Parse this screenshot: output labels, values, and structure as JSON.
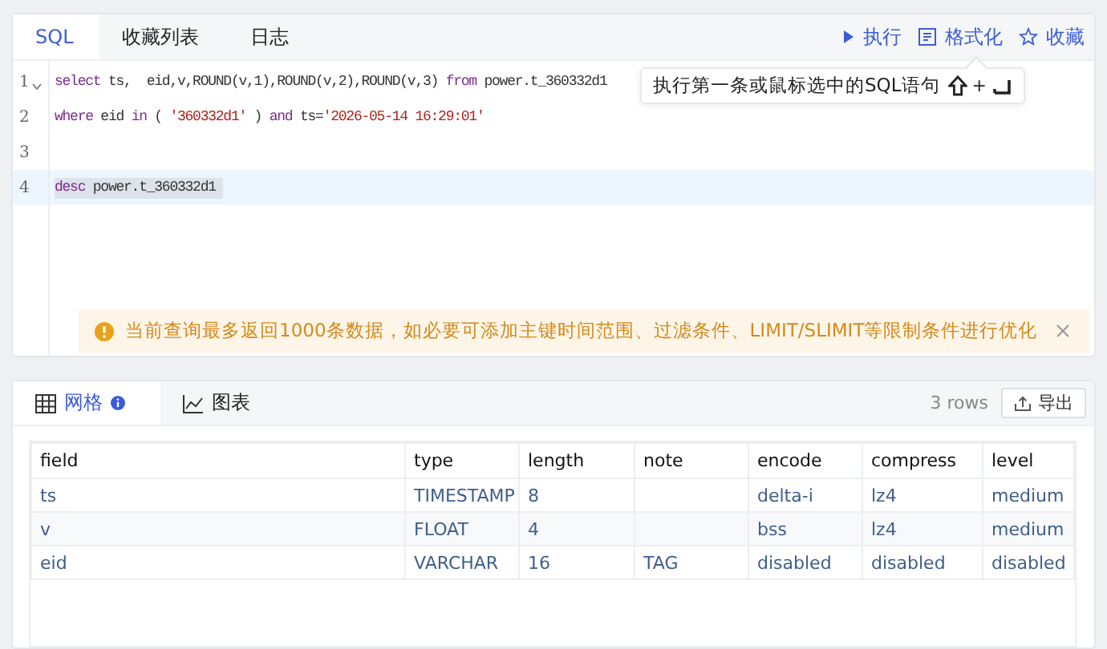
{
  "editor_tabs": [
    {
      "label": "SQL",
      "selected": true
    },
    {
      "label": "收藏列表",
      "selected": false
    },
    {
      "label": "日志",
      "selected": false
    }
  ],
  "toolbar": [
    {
      "kind": "run",
      "label": "执行"
    },
    {
      "kind": "format",
      "label": "格式化"
    },
    {
      "kind": "favorite",
      "label": "收藏"
    }
  ],
  "tooltip": {
    "text": "执行第一条或鼠标选中的SQL语句",
    "plus": "+"
  },
  "code_lines": [
    {
      "number": "1",
      "foldable": true,
      "active": false,
      "selected": false,
      "tokens": [
        {
          "kind": "keyword",
          "text": "select"
        },
        {
          "kind": "plain",
          "text": " ts,  eid,v,ROUND(v,1),ROUND(v,2),ROUND(v,3) "
        },
        {
          "kind": "keyword",
          "text": "from"
        },
        {
          "kind": "plain",
          "text": " power.t_360332d1"
        }
      ]
    },
    {
      "number": "2",
      "foldable": false,
      "active": false,
      "selected": false,
      "tokens": [
        {
          "kind": "keyword",
          "text": "where"
        },
        {
          "kind": "plain",
          "text": " eid "
        },
        {
          "kind": "keyword",
          "text": "in"
        },
        {
          "kind": "plain",
          "text": " ( "
        },
        {
          "kind": "string",
          "text": "'360332d1'"
        },
        {
          "kind": "plain",
          "text": " ) "
        },
        {
          "kind": "keyword",
          "text": "and"
        },
        {
          "kind": "plain",
          "text": " ts="
        },
        {
          "kind": "string",
          "text": "'2026-05-14 16:29:01'"
        }
      ]
    },
    {
      "number": "3",
      "foldable": false,
      "active": false,
      "selected": false
    },
    {
      "number": "4",
      "foldable": false,
      "active": true,
      "selected": true,
      "tokens": [
        {
          "kind": "keyword",
          "text": "desc"
        },
        {
          "kind": "plain",
          "text": " power.t_360332d1 "
        }
      ]
    }
  ],
  "alert": {
    "text": "当前查询最多返回1000条数据，如必要可添加主键时间范围、过滤条件、LIMIT/SLIMIT等限制条件进行优化"
  },
  "result_tabs": [
    {
      "kind": "grid",
      "label": "网格",
      "info": true,
      "selected": true
    },
    {
      "kind": "chart",
      "label": "图表",
      "info": false,
      "selected": false
    }
  ],
  "row_count": "3 rows",
  "export_button": "导出",
  "table": {
    "columns": [
      "field",
      "type",
      "length",
      "note",
      "encode",
      "compress",
      "level"
    ],
    "rows": [
      [
        "ts",
        "TIMESTAMP",
        "8",
        "",
        "delta-i",
        "lz4",
        "medium"
      ],
      [
        "v",
        "FLOAT",
        "4",
        "",
        "bss",
        "lz4",
        "medium"
      ],
      [
        "eid",
        "VARCHAR",
        "16",
        "TAG",
        "disabled",
        "disabled",
        "disabled"
      ]
    ]
  }
}
